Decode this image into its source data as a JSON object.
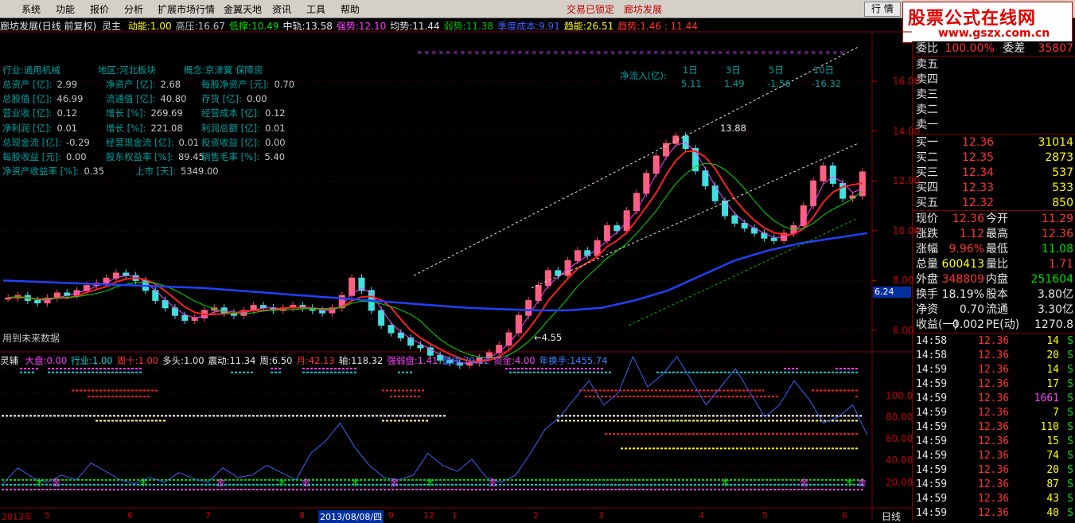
{
  "menu": {
    "items": [
      "系统",
      "功能",
      "报价",
      "分析",
      "扩展市场行情",
      "金翼天地",
      "资讯",
      "工具",
      "帮助"
    ],
    "status": "交易已锁定",
    "stock": "廊坊发展",
    "trade_button": "行 情"
  },
  "logo": {
    "line1": "股票公式在线网",
    "line2": "www.gszx.com.cn"
  },
  "main_header": {
    "title": "廊坊发展(日线 前复权)",
    "indicator": "灵主",
    "items": [
      {
        "label": "动能:",
        "value": "1.00",
        "color": "#ffff00"
      },
      {
        "label": "高压:",
        "value": "16.67",
        "color": "#c0c0c0"
      },
      {
        "label": "低撑:",
        "value": "10.49",
        "color": "#00e000"
      },
      {
        "label": "中轨:",
        "value": "13.58",
        "color": "#e6e6e6"
      },
      {
        "label": "强势:",
        "value": "12.10",
        "color": "#ff40ff"
      },
      {
        "label": "均势:",
        "value": "11.44",
        "color": "#e6e6e6"
      },
      {
        "label": "弱势:",
        "value": "11.38",
        "color": "#00c000"
      },
      {
        "label": "季度成本:",
        "value": "9.91",
        "color": "#4060ff"
      },
      {
        "label": "趋能:",
        "value": "26.51",
        "color": "#ffff00"
      },
      {
        "label": "趋势:",
        "value": "1.46 : 11.44",
        "color": "#ff3232"
      }
    ]
  },
  "fundamentals": {
    "industry": "行业:通用机械",
    "region": "地区:河北板块",
    "concept": "概念:京津冀 保障房",
    "rows": [
      [
        [
          "总资产 [亿]:",
          "2.99"
        ],
        [
          "净资产 [亿]:",
          "2.68"
        ],
        [
          "每股净资产 [元]:",
          "0.70"
        ]
      ],
      [
        [
          "总股值 [亿]:",
          "46.99"
        ],
        [
          "流通值 [亿]:",
          "40.80"
        ],
        [
          "存货 [亿]:",
          "0.00"
        ]
      ],
      [
        [
          "营业收 [亿]:",
          "0.12"
        ],
        [
          "增长 [%]:",
          "269.69"
        ],
        [
          "经营成本 [亿]:",
          "0.12"
        ]
      ],
      [
        [
          "净利润 [亿]:",
          "0.01"
        ],
        [
          "增长 [%]:",
          "221.08"
        ],
        [
          "利润总额 [亿]:",
          "0.01"
        ]
      ],
      [
        [
          "总现金流 [亿]:",
          "-0.29"
        ],
        [
          "经营现金流 [亿]:",
          "0.01"
        ],
        [
          "投资收益 [亿]:",
          "0.00"
        ]
      ],
      [
        [
          "每股收益 [元]:",
          "0.00"
        ],
        [
          "股东权益率 [%]:",
          "89.45"
        ],
        [
          "销售毛率 [%]:",
          "5.40"
        ]
      ],
      [
        [
          "净资产收益率 [%]:",
          "0.35"
        ],
        [
          "上市 [天]:",
          "5349.00"
        ]
      ]
    ],
    "netflow_label": "净流入(亿):",
    "netflow_periods": [
      "1日",
      "3日",
      "5日",
      "10日"
    ],
    "netflow_values": [
      "5.11",
      "1.49",
      "-1.56",
      "-16.32"
    ]
  },
  "chart_annotations": {
    "high": "13.88",
    "low": "4.55",
    "future": "用到未来数据",
    "current_price_tag": "6.24"
  },
  "price_axis": [
    "16.00",
    "14.00",
    "12.00",
    "10.00",
    "8.00",
    "6.00"
  ],
  "sub_header": {
    "title": "灵辅",
    "items": [
      {
        "label": "大盘:",
        "value": "0.00",
        "color": "#ff40ff"
      },
      {
        "label": "行业:",
        "value": "1.00",
        "color": "#00d8d8"
      },
      {
        "label": "周十:",
        "value": "1.00",
        "color": "#ff3232"
      },
      {
        "label": "多头:",
        "value": "1.00",
        "color": "#e6e6e6"
      },
      {
        "label": "震动:",
        "value": "11.34",
        "color": "#e6e6e6"
      },
      {
        "label": "周:",
        "value": "6.50",
        "color": "#e6e6e6"
      },
      {
        "label": "月:",
        "value": "42.13",
        "color": "#ff3232"
      },
      {
        "label": "轴:",
        "value": "118.32",
        "color": "#e6e6e6"
      },
      {
        "label": "强弱盘:",
        "value": "1.41",
        "color": "#ff40ff"
      },
      {
        "label": "量线:",
        "value": "79.12",
        "color": "#4080ff"
      },
      {
        "label": "资金:",
        "value": "4.00",
        "color": "#ff40ff"
      },
      {
        "label": "年换手:",
        "value": "1455.74",
        "color": "#4080ff"
      }
    ]
  },
  "sub_axis": [
    "100.0",
    "80.00",
    "60.00",
    "40.00",
    "20.00"
  ],
  "sub_markers": [
    "木",
    "金",
    "木",
    "金",
    "木",
    "金",
    "木",
    "金",
    "木",
    "金",
    "木",
    "金",
    "木",
    "金"
  ],
  "date_axis": {
    "labels": [
      "2013年",
      "5",
      "6",
      "7",
      "8",
      "2013/08/08/四",
      "9",
      "12",
      "1",
      "2",
      "3",
      "4",
      "5",
      "6"
    ],
    "period": "日线"
  },
  "orderbook": {
    "top_row": {
      "label": "委比",
      "value": "100.00%",
      "label2": "委差",
      "value2": "35807"
    },
    "sells": [
      "卖五",
      "卖四",
      "卖三",
      "卖二",
      "卖一"
    ],
    "buys": [
      {
        "label": "买一",
        "price": "12.36",
        "vol": "31014"
      },
      {
        "label": "买二",
        "price": "12.35",
        "vol": "2873"
      },
      {
        "label": "买三",
        "price": "12.34",
        "vol": "537"
      },
      {
        "label": "买四",
        "price": "12.33",
        "vol": "533"
      },
      {
        "label": "买五",
        "price": "12.32",
        "vol": "850"
      }
    ]
  },
  "quote": [
    {
      "l1": "现价",
      "v1": "12.36",
      "c1": "red",
      "l2": "今开",
      "v2": "11.29",
      "c2": "red"
    },
    {
      "l1": "涨跌",
      "v1": "1.12",
      "c1": "red",
      "l2": "最高",
      "v2": "12.36",
      "c2": "red"
    },
    {
      "l1": "涨幅",
      "v1": "9.96%",
      "c1": "red",
      "l2": "最低",
      "v2": "11.08",
      "c2": "green"
    },
    {
      "l1": "总量",
      "v1": "600413",
      "c1": "yellow",
      "l2": "量比",
      "v2": "1.71",
      "c2": "red"
    },
    {
      "l1": "外盘",
      "v1": "348809",
      "c1": "red",
      "l2": "内盘",
      "v2": "251604",
      "c2": "green"
    },
    {
      "l1": "换手",
      "v1": "18.19%",
      "c1": "white",
      "l2": "股本",
      "v2": "3.80亿",
      "c2": "white"
    },
    {
      "l1": "净资",
      "v1": "0.70",
      "c1": "white",
      "l2": "流通",
      "v2": "3.30亿",
      "c2": "white"
    },
    {
      "l1": "收益(一)",
      "v1": "0.002",
      "c1": "white",
      "l2": "PE(动)",
      "v2": "1270.8",
      "c2": "white"
    }
  ],
  "ticks": [
    {
      "time": "14:58",
      "price": "12.36",
      "vol": "14",
      "side": "S"
    },
    {
      "time": "14:58",
      "price": "12.36",
      "vol": "20",
      "side": "S"
    },
    {
      "time": "14:59",
      "price": "12.36",
      "vol": "14",
      "side": "S"
    },
    {
      "time": "14:59",
      "price": "12.36",
      "vol": "17",
      "side": "S"
    },
    {
      "time": "14:59",
      "price": "12.36",
      "vol": "1661",
      "side": "S"
    },
    {
      "time": "14:59",
      "price": "12.36",
      "vol": "7",
      "side": "S"
    },
    {
      "time": "14:59",
      "price": "12.36",
      "vol": "110",
      "side": "S"
    },
    {
      "time": "14:59",
      "price": "12.36",
      "vol": "15",
      "side": "S"
    },
    {
      "time": "14:59",
      "price": "12.36",
      "vol": "74",
      "side": "S"
    },
    {
      "time": "14:59",
      "price": "12.36",
      "vol": "20",
      "side": "S"
    },
    {
      "time": "14:59",
      "price": "12.36",
      "vol": "87",
      "side": "S"
    },
    {
      "time": "14:59",
      "price": "12.36",
      "vol": "43",
      "side": "S"
    },
    {
      "time": "14:59",
      "price": "12.36",
      "vol": "40",
      "side": "S"
    }
  ],
  "chart_data": {
    "type": "candlestick",
    "ylim": [
      5.2,
      17.6
    ],
    "y_ticks": [
      6,
      8,
      10,
      12,
      14,
      16
    ],
    "close_series": [
      7.3,
      7.4,
      7.2,
      7.1,
      7.3,
      7.5,
      7.4,
      7.6,
      7.8,
      7.9,
      8.1,
      8.3,
      8.2,
      8.0,
      7.6,
      7.2,
      6.9,
      6.6,
      6.4,
      6.5,
      6.8,
      6.9,
      6.7,
      6.6,
      6.8,
      7.0,
      6.9,
      6.8,
      6.9,
      7.0,
      6.9,
      6.8,
      6.7,
      6.9,
      7.4,
      8.1,
      7.6,
      6.8,
      6.2,
      5.9,
      5.7,
      5.4,
      5.3,
      5.0,
      4.8,
      4.7,
      4.6,
      4.7,
      4.9,
      5.1,
      5.4,
      5.9,
      6.6,
      7.2,
      7.8,
      8.4,
      8.2,
      8.8,
      9.2,
      9.0,
      9.6,
      10.2,
      10.0,
      10.8,
      11.5,
      12.3,
      13.0,
      13.5,
      13.8,
      13.3,
      12.4,
      11.8,
      11.2,
      10.6,
      10.3,
      10.1,
      9.9,
      9.7,
      9.6,
      9.9,
      10.2,
      11.0,
      12.0,
      12.6,
      11.9,
      11.3,
      11.4,
      12.36
    ],
    "ma_blue": [
      8.0,
      7.95,
      7.9,
      7.85,
      7.8,
      7.75,
      7.7,
      7.6,
      7.5,
      7.4,
      7.3,
      7.2,
      7.1,
      7.0,
      6.9,
      6.85,
      6.8,
      6.8,
      6.9,
      7.2,
      7.6,
      8.2,
      8.8,
      9.2,
      9.5,
      9.7,
      9.9
    ],
    "high": 13.88,
    "low": 4.55
  }
}
